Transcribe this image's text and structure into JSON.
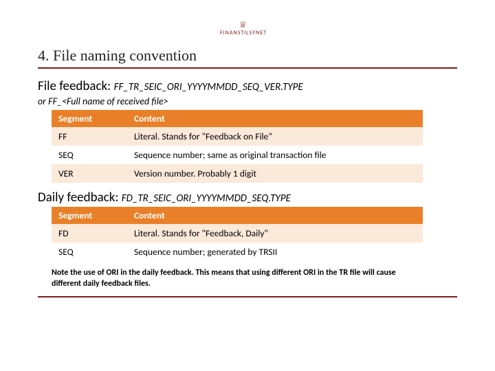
{
  "brand": {
    "name": "FINANSTILSYNET"
  },
  "title": "4. File naming convention",
  "file_feedback": {
    "label": "File feedback:",
    "pattern": "FF_TR_SEIC_ORI_YYYYMMDD_SEQ_VER.TYPE",
    "alt": "or FF_<Full name of received file>",
    "headers": {
      "seg": "Segment",
      "content": "Content"
    },
    "rows": [
      {
        "seg": "FF",
        "content": "Literal. Stands for \"Feedback on File\""
      },
      {
        "seg": "SEQ",
        "content": "Sequence number; same as original transaction file"
      },
      {
        "seg": "VER",
        "content": "Version number. Probably 1 digit"
      }
    ]
  },
  "daily_feedback": {
    "label": "Daily feedback:",
    "pattern": "FD_TR_SEIC_ORI_YYYYMMDD_SEQ.TYPE",
    "headers": {
      "seg": "Segment",
      "content": "Content"
    },
    "rows": [
      {
        "seg": "FD",
        "content": "Literal. Stands for \"Feedback, Daily\""
      },
      {
        "seg": "SEQ",
        "content": "Sequence number; generated by TRSII"
      }
    ],
    "note": "Note the use of ORI in the daily feedback. This means that using different ORI in the TR file will cause different daily feedback files."
  }
}
